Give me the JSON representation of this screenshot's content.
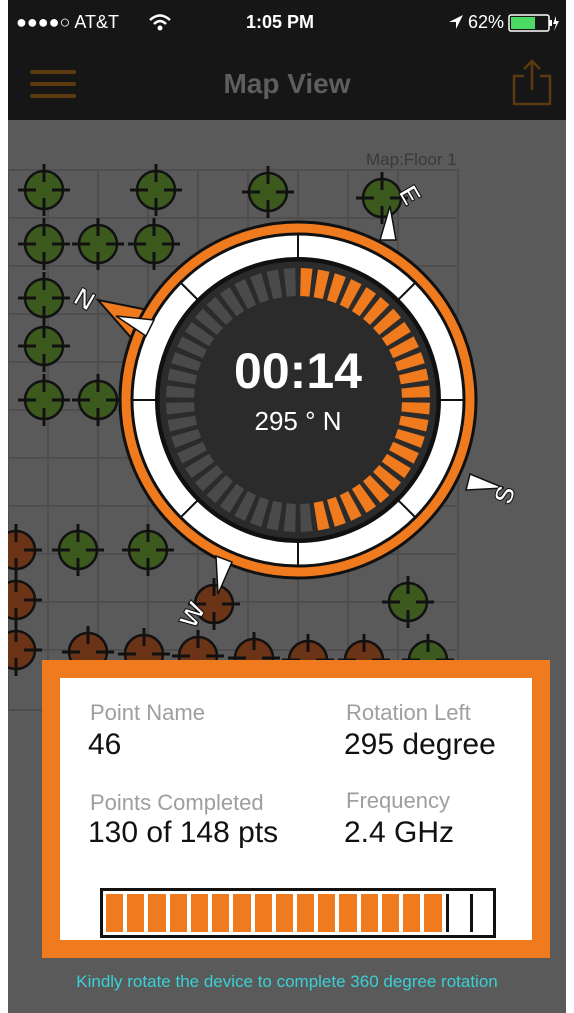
{
  "status_bar": {
    "carrier": "●●●●○ AT&T",
    "time": "1:05 PM",
    "battery": "62%"
  },
  "nav": {
    "title": "Map View",
    "menu_icon": "hamburger-menu-icon",
    "share_icon": "share-icon"
  },
  "map": {
    "label": "Map:Floor 1"
  },
  "compass": {
    "timer": "00:14",
    "heading": "295 ° N",
    "progress_fraction": 0.48,
    "markers": {
      "n": "N",
      "e": "E",
      "s": "S",
      "w": "W"
    }
  },
  "info": {
    "point_name_label": "Point Name",
    "point_name_value": "46",
    "rotation_left_label": "Rotation Left",
    "rotation_left_value": "295 degree",
    "points_completed_label": "Points Completed",
    "points_completed_value": "130 of 148 pts",
    "frequency_label": "Frequency",
    "frequency_value": "2.4 GHz",
    "progress_filled": 16,
    "progress_total": 18
  },
  "hint": "Kindly rotate the device to complete 360 degree rotation",
  "colors": {
    "accent": "#f07a1e",
    "hint": "#3ad1d6",
    "bar": "#161616"
  }
}
